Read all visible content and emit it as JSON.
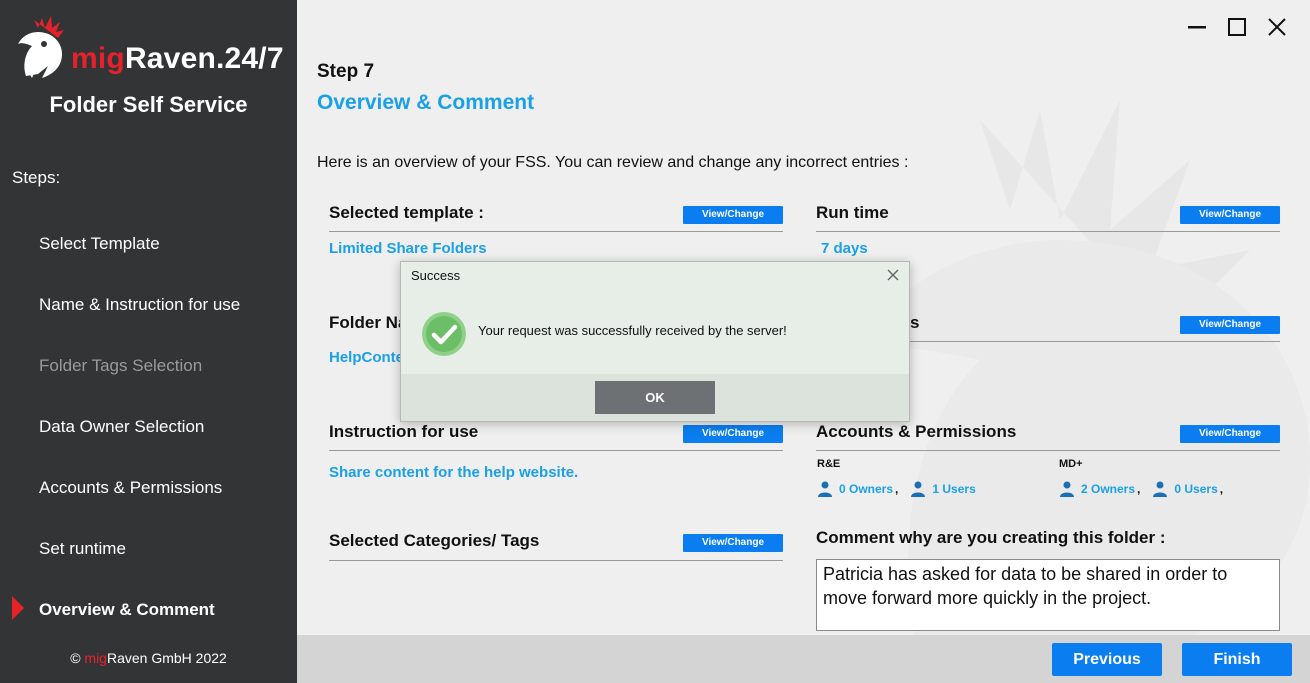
{
  "sidebar": {
    "brand_mig": "mig",
    "brand_rest": "Raven.24/7",
    "subtitle": "Folder Self Service",
    "steps_label": "Steps:",
    "steps": [
      {
        "label": "Select Template"
      },
      {
        "label": "Name & Instruction for use"
      },
      {
        "label": "Folder Tags Selection"
      },
      {
        "label": "Data Owner Selection"
      },
      {
        "label": "Accounts & Permissions"
      },
      {
        "label": "Set runtime"
      },
      {
        "label": "Overview & Comment"
      }
    ],
    "copyright_prefix": "©",
    "copyright_mig": "mig",
    "copyright_rest": "Raven GmbH 2022"
  },
  "header": {
    "step_number": "Step 7",
    "step_title": "Overview & Comment",
    "intro": "Here is an overview of your FSS. You can review and change any incorrect entries :"
  },
  "view_change_label": "View/Change",
  "sections": {
    "template_title": "Selected template :",
    "template_value": "Limited Share Folders",
    "runtime_title": "Run time",
    "runtime_value": "7 days",
    "folder_name_title": "Folder Na",
    "folder_name_value": "HelpConte",
    "owners_title_tail": "s",
    "instruction_title": "Instruction for use",
    "instruction_value": "Share content for the help website.",
    "accounts_title": "Accounts & Permissions",
    "categories_title": "Selected Categories/ Tags",
    "comment_title": "Comment why are you creating this folder :",
    "comment_value": "Patricia has asked for data to be shared in order to move forward more quickly in the project."
  },
  "accounts": {
    "group1_label": "R&E",
    "group1_owners": "0 Owners",
    "group1_users": "1 Users",
    "group2_label": "MD+",
    "group2_owners": "2 Owners",
    "group2_users": "0 Users",
    "separator": ","
  },
  "footer": {
    "previous": "Previous",
    "finish": "Finish"
  },
  "dialog": {
    "title": "Success",
    "message": "Your request was successfully received by the server!",
    "ok": "OK"
  },
  "colors": {
    "accent": "#1aa0e6",
    "button": "#0a7ef1",
    "brand_red": "#e5222c",
    "sidebar_bg": "#333435"
  }
}
